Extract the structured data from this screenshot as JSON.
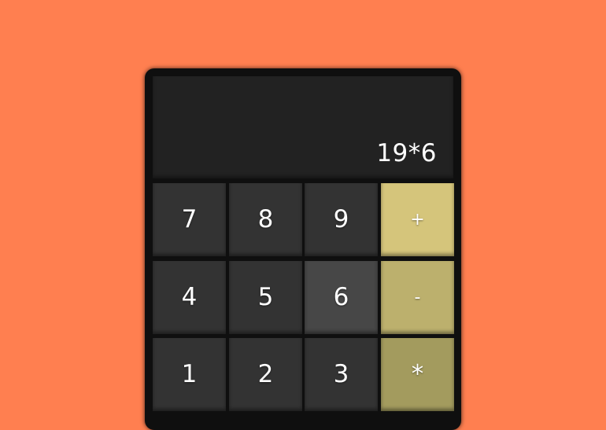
{
  "display": {
    "value": "19*6"
  },
  "keypad": {
    "rows": [
      [
        {
          "label": "7",
          "type": "number"
        },
        {
          "label": "8",
          "type": "number"
        },
        {
          "label": "9",
          "type": "number"
        },
        {
          "label": "+",
          "type": "operator",
          "color": "#d5c57b"
        }
      ],
      [
        {
          "label": "4",
          "type": "number"
        },
        {
          "label": "5",
          "type": "number"
        },
        {
          "label": "6",
          "type": "number",
          "state": "hover"
        },
        {
          "label": "-",
          "type": "operator",
          "color": "#bcb06d"
        }
      ],
      [
        {
          "label": "1",
          "type": "number"
        },
        {
          "label": "2",
          "type": "number"
        },
        {
          "label": "3",
          "type": "number"
        },
        {
          "label": "*",
          "type": "operator",
          "color": "#a39b5e"
        }
      ]
    ]
  },
  "colors": {
    "background": "#ff7f50",
    "calculator_frame": "#0f0f0f",
    "display": "#222222",
    "number_key": "#333333",
    "number_key_active": "#474747",
    "text": "#ffffff"
  }
}
